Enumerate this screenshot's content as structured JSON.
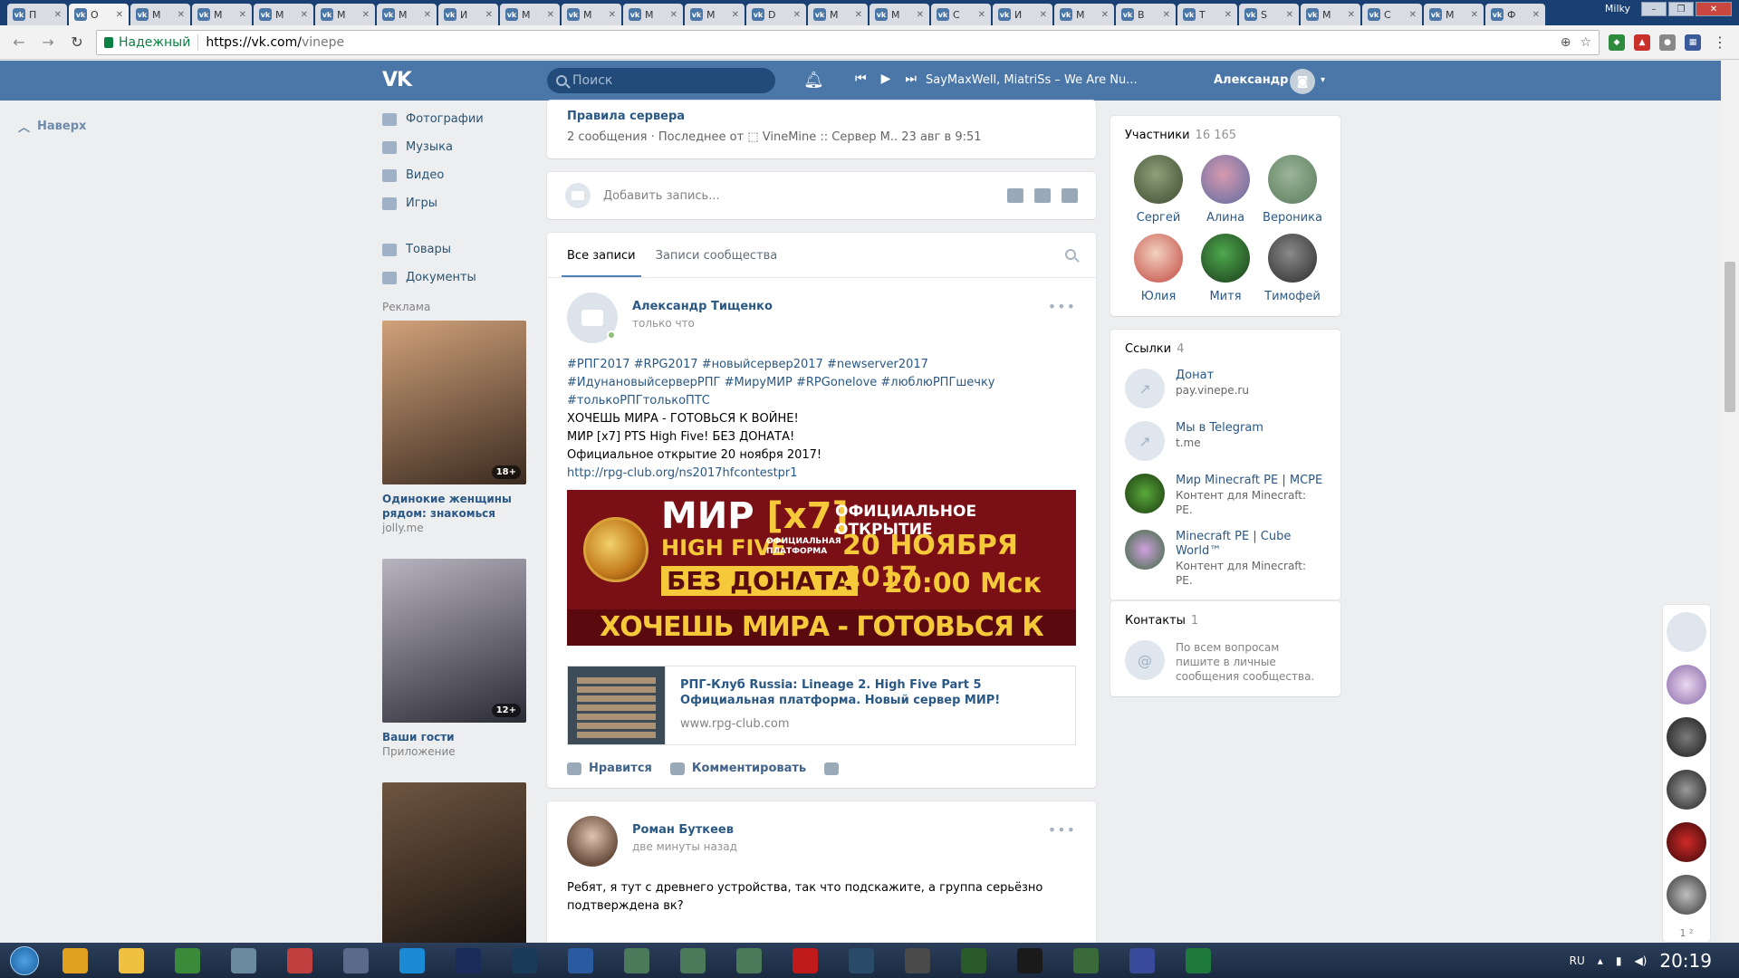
{
  "browser": {
    "profile_name": "Milky",
    "tabs": [
      {
        "label": "П"
      },
      {
        "label": "О"
      },
      {
        "label": "М"
      },
      {
        "label": "М"
      },
      {
        "label": "М"
      },
      {
        "label": "М"
      },
      {
        "label": "М"
      },
      {
        "label": "И"
      },
      {
        "label": "М"
      },
      {
        "label": "М"
      },
      {
        "label": "М"
      },
      {
        "label": "М"
      },
      {
        "label": "D"
      },
      {
        "label": "М"
      },
      {
        "label": "М"
      },
      {
        "label": "C"
      },
      {
        "label": "И"
      },
      {
        "label": "М"
      },
      {
        "label": "В"
      },
      {
        "label": "Т"
      },
      {
        "label": "S"
      },
      {
        "label": "М"
      },
      {
        "label": "С"
      },
      {
        "label": "М"
      },
      {
        "label": "Ф"
      }
    ],
    "secure_label": "Надежный",
    "url_host": "https://vk.com/",
    "url_path": "vinepe"
  },
  "vk_header": {
    "logo": "VK",
    "search_placeholder": "Поиск",
    "track": "SayMaxWell, MiatriSs – We Are Nu...",
    "user_name": "Александр"
  },
  "left": {
    "to_top": "Наверх",
    "menu": [
      {
        "label": "Фотографии",
        "icon": "camera-icon"
      },
      {
        "label": "Музыка",
        "icon": "music-icon"
      },
      {
        "label": "Видео",
        "icon": "video-icon"
      },
      {
        "label": "Игры",
        "icon": "gamepad-icon"
      }
    ],
    "menu2": [
      {
        "label": "Товары",
        "icon": "bag-icon"
      },
      {
        "label": "Документы",
        "icon": "document-icon"
      }
    ],
    "ads_label": "Реклама",
    "ads": [
      {
        "title": "Одинокие женщины рядом: знакомься",
        "sub": "jolly.me",
        "age": "18+",
        "color_a": "#3a2a20",
        "color_b": "#d1a27a"
      },
      {
        "title": "Ваши гости",
        "sub": "Приложение",
        "age": "12+",
        "color_a": "#2a2a35",
        "color_b": "#b8b4bf"
      },
      {
        "title": "",
        "sub": "",
        "age": "",
        "color_a": "#1a1410",
        "color_b": "#6e5540"
      }
    ]
  },
  "topic": {
    "title": "Правила сервера",
    "meta": "2 сообщения · Последнее от ⬚ VineMine :: Сервер М.. 23 авг в 9:51"
  },
  "compose": {
    "placeholder": "Добавить запись..."
  },
  "feed_tabs": {
    "all": "Все записи",
    "community": "Записи сообщества"
  },
  "post1": {
    "author": "Александр Тищенко",
    "time": "только что",
    "tags": "#РПГ2017 #RPG2017 #новыйсервер2017 #newserver2017 #ИдунановыйсерверРПГ #МируМИР #RPGonelove #люблюРПГшечку #толькоРПГтолькоПТС",
    "line1": "ХОЧЕШЬ МИРА - ГОТОВЬСЯ К ВОЙНЕ!",
    "line2": "МИР [x7] PTS High Five! БЕЗ ДОНАТА!",
    "line3": "Официальное открытие 20 ноября 2017!",
    "link": "http://rpg-club.org/ns2017hfcontestpr1",
    "banner": {
      "mir": "МИР ",
      "x7": "[x7]",
      "hf": "HIGH FIVE",
      "hf_small": "ОФИЦИАЛЬНАЯ ПЛАТФОРМА",
      "no_donate": "БЕЗ ДОНАТА",
      "official": "ОФИЦИАЛЬНОЕ ОТКРЫТИЕ",
      "date": "20 НОЯБРЯ 2017",
      "time": "20:00 Мск",
      "bottom": "ХОЧЕШЬ МИРА - ГОТОВЬСЯ К ВОЙНЕ"
    },
    "snippet_title": "РПГ-Клуб Russia: Lineage 2. High Five Part 5 Официальная платформа. Новый сервер МИР!",
    "snippet_url": "www.rpg-club.com",
    "like": "Нравится",
    "comment": "Комментировать"
  },
  "post2": {
    "author": "Роман Буткеев",
    "time": "две минуты назад",
    "text": "Ребят, я тут с древнего устройства, так что подскажите, а группа серьёзно подтверждена вк?"
  },
  "members": {
    "title": "Участники",
    "count": "16 165",
    "list": [
      {
        "name": "Сергей",
        "c1": "#8ea07a",
        "c2": "#3b4a2e"
      },
      {
        "name": "Алина",
        "c1": "#d79ab0",
        "c2": "#5d6aa0"
      },
      {
        "name": "Вероника",
        "c1": "#9bb59a",
        "c2": "#5a7a5a"
      },
      {
        "name": "Юлия",
        "c1": "#f2d1c0",
        "c2": "#c2473e"
      },
      {
        "name": "Митя",
        "c1": "#4ea84e",
        "c2": "#1a3a1a"
      },
      {
        "name": "Тимофей",
        "c1": "#8a8a8a",
        "c2": "#2a2a2a"
      }
    ]
  },
  "links": {
    "title": "Ссылки",
    "count": "4",
    "list": [
      {
        "title": "Донат",
        "sub": "pay.vinepe.ru"
      },
      {
        "title": "Мы в Telegram",
        "sub": "t.me"
      },
      {
        "title": "Мир Minecraft PE | MCPE",
        "sub": "Контент для Minecraft: PE."
      },
      {
        "title": "Minecraft PE | Cube World™",
        "sub": "Контент для Minecraft: PE."
      }
    ]
  },
  "contacts": {
    "title": "Контакты",
    "count": "1",
    "text": "По всем вопросам пишите в личные сообщения сообщества."
  },
  "chat": {
    "count": "1 ²"
  },
  "taskbar": {
    "lang": "RU",
    "clock": "20:19"
  }
}
